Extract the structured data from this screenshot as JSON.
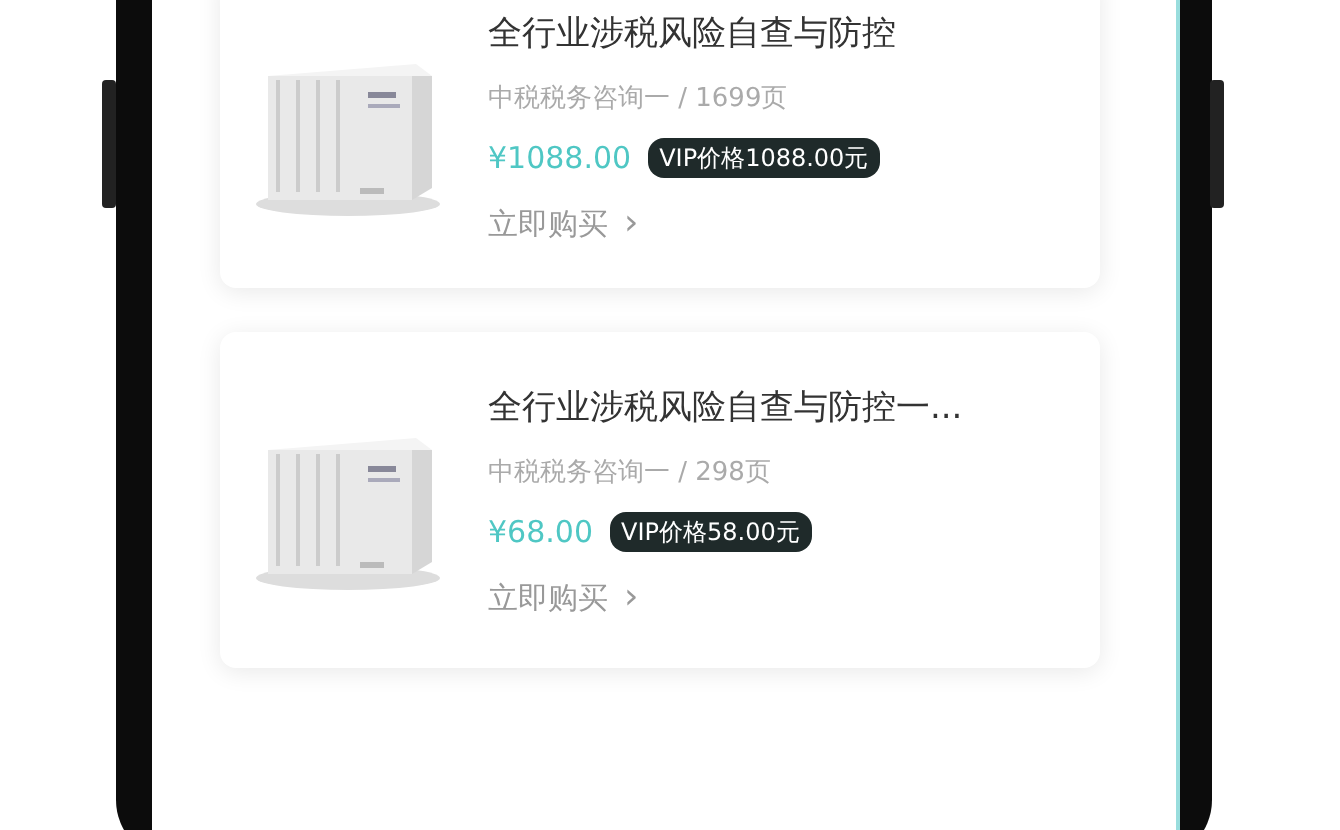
{
  "products": [
    {
      "title": "全行业涉税风险自查与防控",
      "publisher": "中税税务咨询一 / 1699页",
      "price": "¥1088.00",
      "vip_price": "VIP价格1088.00元",
      "buy": "立即购买",
      "buy_icon": "›"
    },
    {
      "title": "全行业涉税风险自查与防控一...",
      "publisher": "中税税务咨询一 / 298页",
      "price": "¥68.00",
      "vip_price": "VIP价格58.00元",
      "buy": "立即购买",
      "buy_icon": "›"
    }
  ]
}
